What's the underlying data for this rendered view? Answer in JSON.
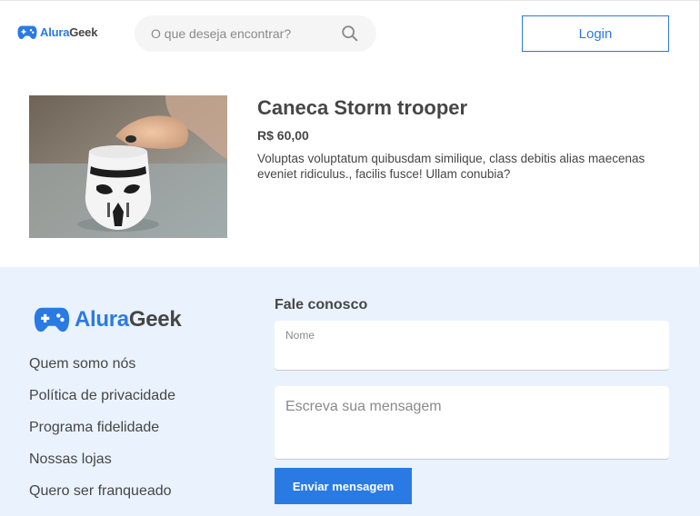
{
  "header": {
    "logo": {
      "brand_first": "Alura",
      "brand_second": "Geek",
      "icon": "gamepad-icon"
    },
    "search": {
      "placeholder": "O que deseja encontrar?",
      "value": "",
      "icon": "search-icon"
    },
    "login_label": "Login"
  },
  "product": {
    "title": "Caneca Storm trooper",
    "price": "R$ 60,00",
    "description": "Voluptas voluptatum quibusdam similique, class debitis alias maecenas eveniet ridiculus., facilis fusce! Ullam conubia?",
    "image": "stormtrooper-mug-photo"
  },
  "footer": {
    "logo": {
      "brand_first": "Alura",
      "brand_second": "Geek",
      "icon": "gamepad-icon"
    },
    "links": [
      {
        "label": "Quem somo nós"
      },
      {
        "label": "Política de privacidade"
      },
      {
        "label": "Programa fidelidade"
      },
      {
        "label": "Nossas lojas"
      },
      {
        "label": "Quero ser franqueado"
      }
    ],
    "contact": {
      "title": "Fale conosco",
      "name_label": "Nome",
      "name_value": "",
      "message_placeholder": "Escreva sua mensagem",
      "submit_label": "Enviar mensagem"
    }
  },
  "colors": {
    "accent": "#2a7ae4",
    "text": "#464646",
    "footer_bg": "#eaf2fd",
    "search_bg": "#f5f5f5"
  }
}
